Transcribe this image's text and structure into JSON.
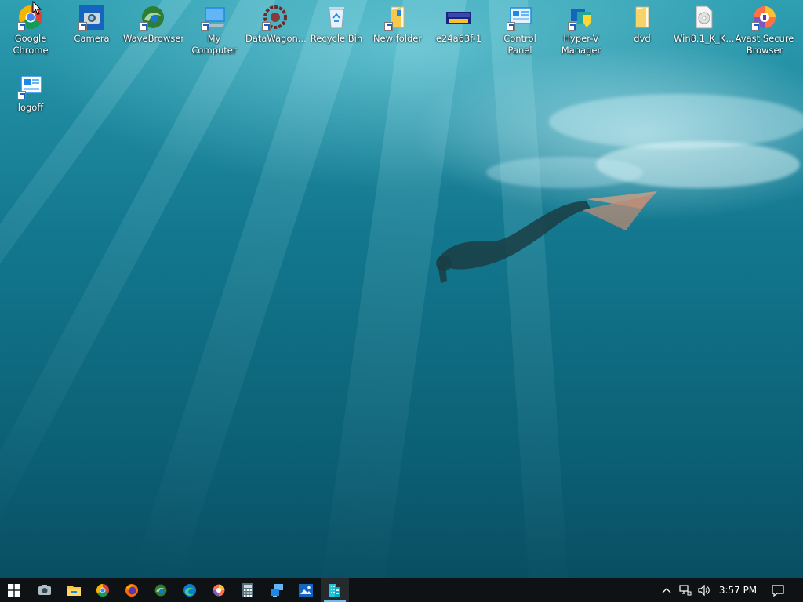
{
  "desktop": {
    "icons": [
      {
        "label": "Google Chrome",
        "icon": "chrome-icon"
      },
      {
        "label": "Camera",
        "icon": "camera-icon"
      },
      {
        "label": "WaveBrowser",
        "icon": "wavebrowser-icon"
      },
      {
        "label": "My Computer",
        "icon": "computer-icon"
      },
      {
        "label": "DataWagon...",
        "icon": "datawagon-icon"
      },
      {
        "label": "Recycle Bin",
        "icon": "recycle-bin-icon"
      },
      {
        "label": "New folder",
        "icon": "folder-icon"
      },
      {
        "label": "e24a63f-1",
        "icon": "image-file-icon"
      },
      {
        "label": "Control Panel",
        "icon": "control-panel-icon"
      },
      {
        "label": "Hyper-V Manager",
        "icon": "hyperv-icon"
      },
      {
        "label": "dvd",
        "icon": "folder-icon"
      },
      {
        "label": "Win8.1_K_K...",
        "icon": "disc-image-icon"
      },
      {
        "label": "Avast Secure Browser",
        "icon": "avast-browser-icon"
      },
      {
        "label": "logoff",
        "icon": "logoff-icon"
      }
    ]
  },
  "taskbar": {
    "start": {
      "icon": "windows-start-icon"
    },
    "pinned": [
      {
        "name": "camera",
        "icon": "camera-icon"
      },
      {
        "name": "file-explorer",
        "icon": "file-explorer-icon"
      },
      {
        "name": "chrome",
        "icon": "chrome-icon"
      },
      {
        "name": "firefox",
        "icon": "firefox-icon"
      },
      {
        "name": "wavebrowser",
        "icon": "wavebrowser-icon"
      },
      {
        "name": "edge",
        "icon": "edge-icon"
      },
      {
        "name": "avast-browser",
        "icon": "avast-browser-icon"
      },
      {
        "name": "calculator",
        "icon": "calculator-icon"
      },
      {
        "name": "remote-desktop",
        "icon": "remote-desktop-icon"
      },
      {
        "name": "photos",
        "icon": "photos-icon"
      },
      {
        "name": "taskbar-app",
        "icon": "building-app-icon"
      }
    ],
    "tray": {
      "chevron": "^",
      "network_icon": "network-icon",
      "volume_icon": "volume-icon",
      "notification_icon": "notification-icon"
    },
    "clock": "3:57 PM"
  }
}
